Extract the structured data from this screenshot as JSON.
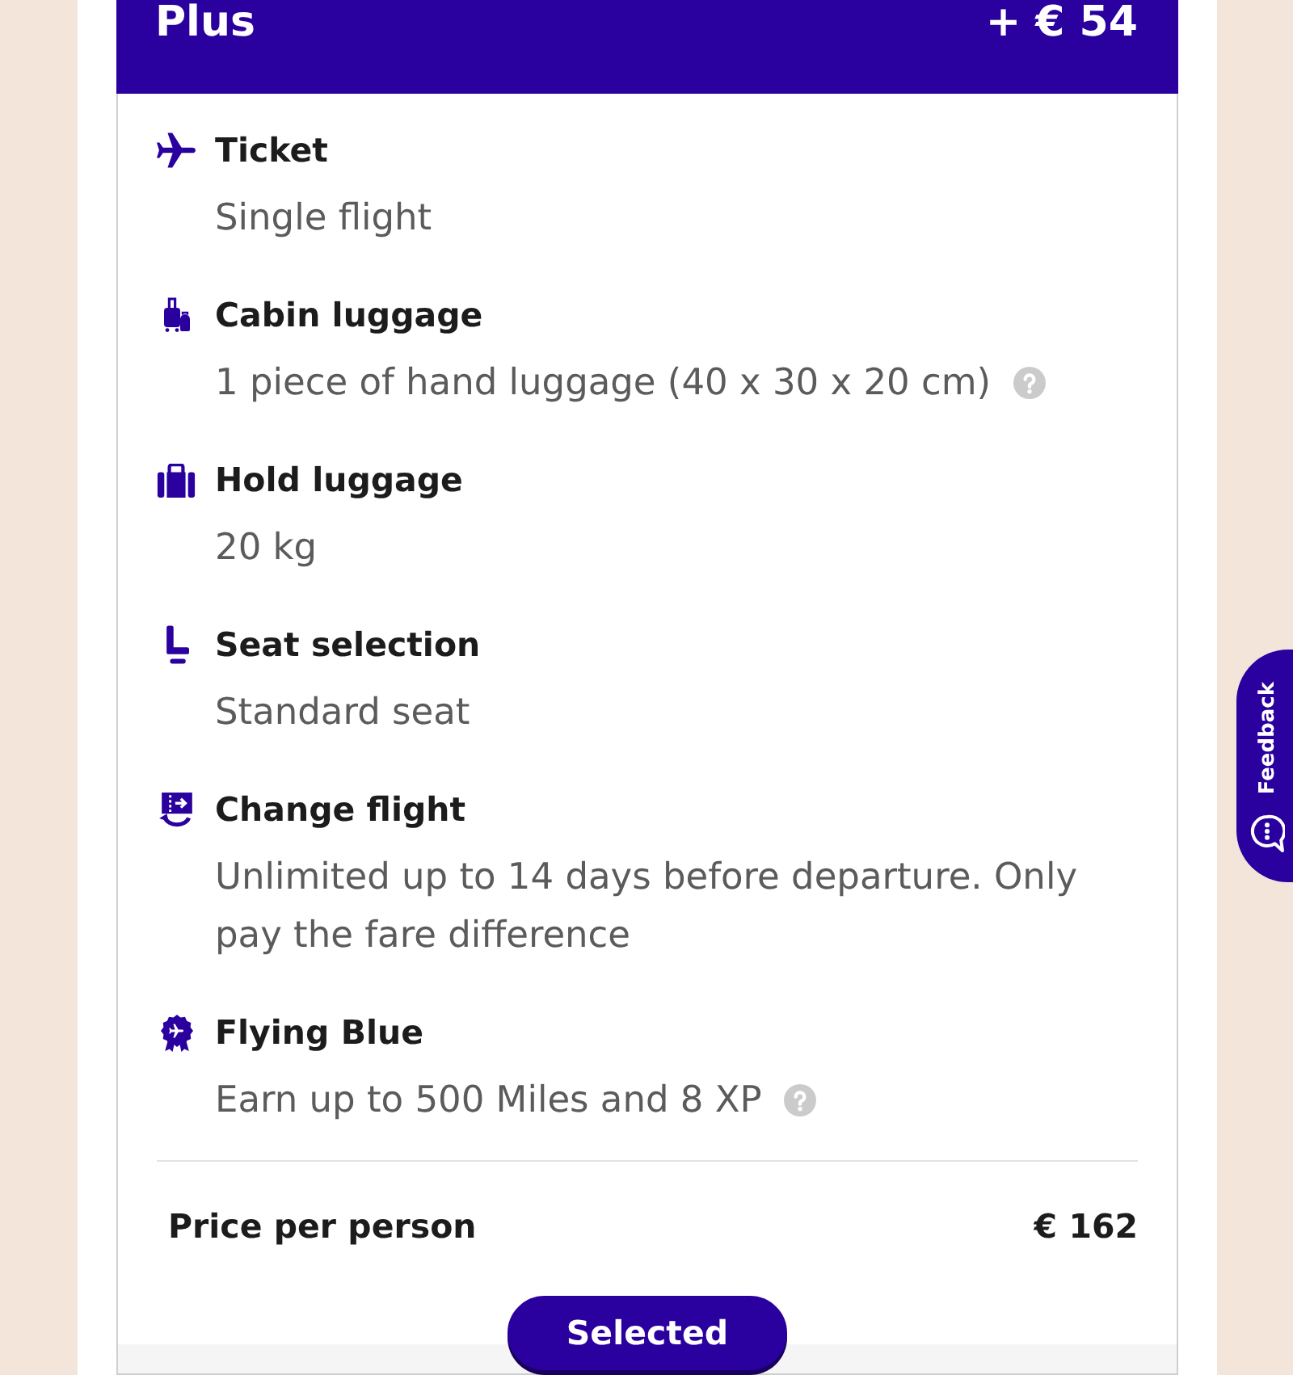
{
  "fare": {
    "name": "Plus",
    "price_difference": "+ € 54"
  },
  "features": [
    {
      "kind": "ticket",
      "title": "Ticket",
      "description": "Single flight",
      "help_icon": false
    },
    {
      "kind": "cabin_luggage",
      "title": "Cabin luggage",
      "description": "1 piece of hand luggage (40 x 30 x 20 cm)",
      "help_icon": true
    },
    {
      "kind": "hold_luggage",
      "title": "Hold luggage",
      "description": "20 kg",
      "help_icon": false
    },
    {
      "kind": "seat",
      "title": "Seat selection",
      "description": "Standard seat",
      "help_icon": false
    },
    {
      "kind": "change",
      "title": "Change flight",
      "description": "Unlimited up to 14 days before departure. Only pay the fare difference",
      "help_icon": false
    },
    {
      "kind": "loyalty",
      "title": "Flying Blue",
      "description": "Earn up to 500 Miles and 8 XP",
      "help_icon": true
    }
  ],
  "price": {
    "label": "Price per person",
    "value": "€ 162"
  },
  "select_button": {
    "label": "Selected",
    "selected": true
  },
  "feedback_tab": {
    "label": "Feedback"
  }
}
